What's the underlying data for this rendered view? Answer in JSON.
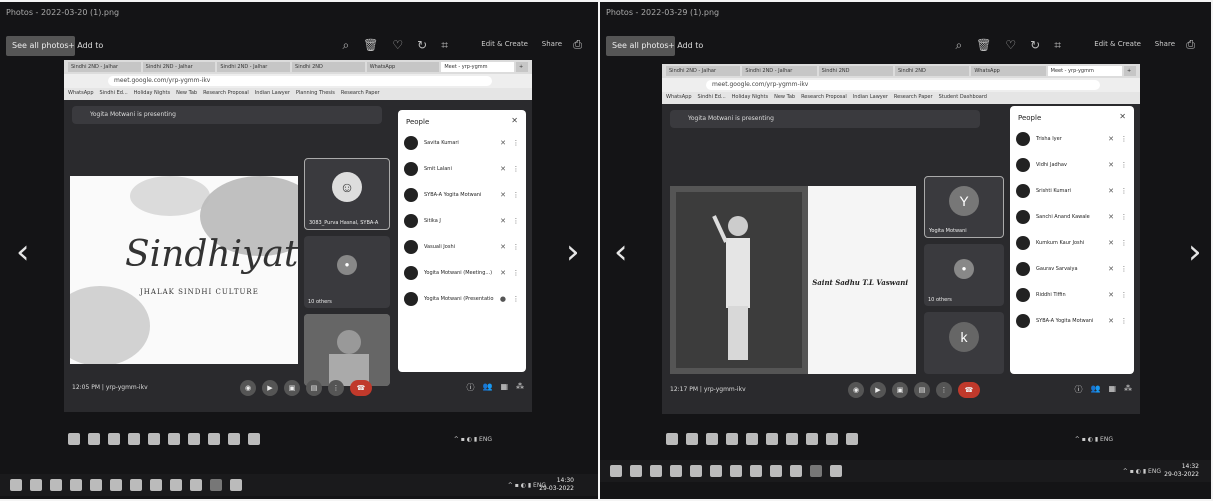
{
  "left": {
    "title": "Photos - 2022-03-20 (1).png",
    "toolbar": {
      "view_all": "See all photos",
      "add_album": "+ Add to",
      "edit": "Edit & Create",
      "share": "Share"
    },
    "tabs": [
      "Sindhi 2ND - Jalhar",
      "Sindhi 2ND - Jalhar",
      "Sindhi 2ND - Jalhar",
      "Sindhi 2ND",
      "WhatsApp",
      "Meet - yrp-ygmm",
      "+"
    ],
    "url": "meet.google.com/yrp-ygmm-ikv",
    "bookmarks": [
      "WhatsApp",
      "Sindhi Ed...",
      "Holiday Nights",
      "New Tab",
      "Research Proposal",
      "Indian Lawyer",
      "Planning Thesis",
      "Research Paper"
    ],
    "presenting": "Yogita Motwani is presenting",
    "slide_title": "Sindhiyat",
    "slide_subtitle": "JHALAK SINDHI CULTURE",
    "tile_label": "3083_Purva Hasnal, SYBA-A",
    "others": "10 others",
    "people_title": "People",
    "people": [
      "Savita Kumari",
      "Smit Lalani",
      "SYBA-A Yogita Motwani",
      "Sitika J",
      "Vasuali Joshi",
      "Yogita Motwani (Meeting...)",
      "Yogita Motwani (Presentation)"
    ],
    "time": "12:05 PM | yrp-ygmm-ikv",
    "taskbar_time": "14:30",
    "taskbar_date": "29-03-2022"
  },
  "right": {
    "title": "Photos - 2022-03-29 (1).png",
    "toolbar": {
      "view_all": "See all photos",
      "add_album": "+ Add to",
      "edit": "Edit & Create",
      "share": "Share"
    },
    "tabs": [
      "Sindhi 2ND - Jalhar",
      "Sindhi 2ND - Jalhar",
      "Sindhi 2ND",
      "Sindhi 2ND",
      "WhatsApp",
      "Meet - yrp-ygmm",
      "+"
    ],
    "url": "meet.google.com/yrp-ygmm-ikv",
    "bookmarks": [
      "WhatsApp",
      "Sindhi Ed...",
      "Holiday Nights",
      "New Tab",
      "Research Proposal",
      "Indian Lawyer",
      "Research Paper",
      "Student Dashboard"
    ],
    "presenting": "Yogita Motwani is presenting",
    "slide_text": "Saint Sadhu T.L Vaswani",
    "tile_avatar": "Y",
    "tile_label": "Yogita Motwani",
    "others": "10 others",
    "tile_k": "k",
    "people_title": "People",
    "people": [
      "Trisha Iyer",
      "Vidhi Jadhav",
      "Srishti Kumari",
      "Sanchi Anand Kawale",
      "Kumkum Kaur Joshi",
      "Gaurav Sarvaiya",
      "Riddhi Tiffin",
      "SYBA-A Yogita Motwani"
    ],
    "time": "12:17 PM | yrp-ygmm-ikv",
    "taskbar_time": "14:32",
    "taskbar_date": "29-03-2022"
  },
  "icons": {
    "prev": "‹",
    "next": "›",
    "mic": "🎙",
    "more": "⋮",
    "close": "✕"
  }
}
